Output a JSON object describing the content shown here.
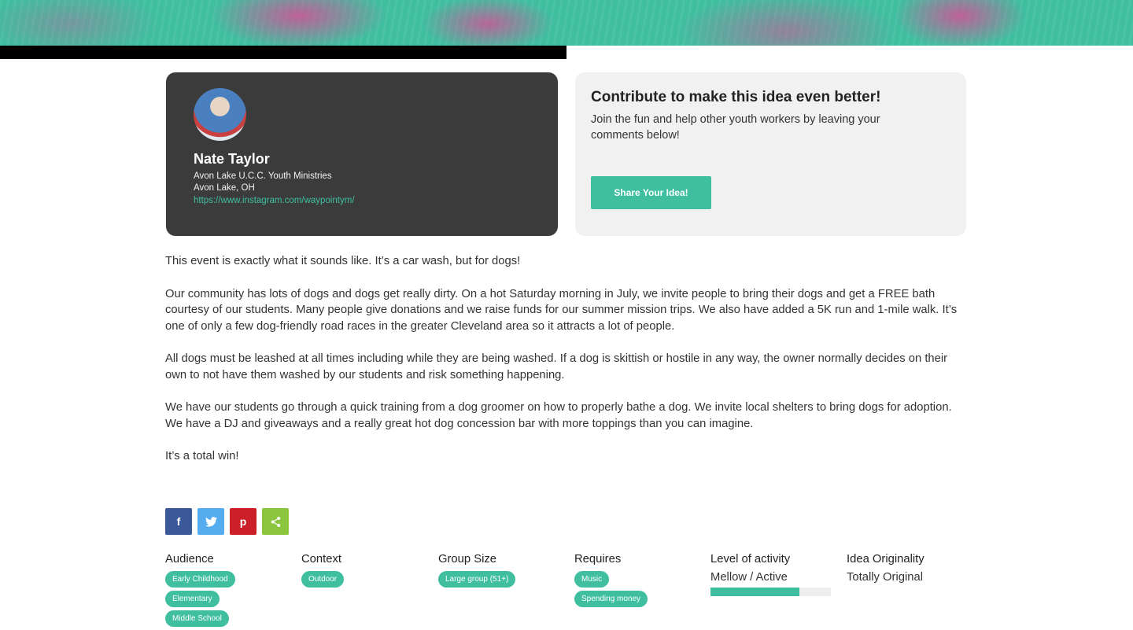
{
  "author": {
    "name": "Nate Taylor",
    "org": "Avon Lake U.C.C. Youth Ministries",
    "location": "Avon Lake, OH",
    "link": "https://www.instagram.com/waypointym/"
  },
  "contribute": {
    "title": "Contribute to make this idea even better!",
    "text": "Join the fun and help other youth workers by leaving your comments below!",
    "button": "Share Your Idea!"
  },
  "article": {
    "p1": "This event is exactly what it sounds like. It’s a car wash, but for dogs!",
    "p2": "Our community has lots of dogs and dogs get really dirty. On a hot Saturday morning in July,  we invite people to bring their dogs and get a FREE bath courtesy of our students. Many people give donations and we raise funds for our summer mission trips. We also have added a 5K run and 1-mile walk. It’s one of only a few dog-friendly road races in the greater Cleveland area so it attracts a lot of people.",
    "p3": "All dogs must be leashed at all times including while they are being washed. If a dog is skittish or hostile in any way, the owner normally decides on their own to not have them washed by our students and risk something happening.",
    "p4": "We have our students go through a quick training from a dog groomer on how to properly bathe a dog. We invite local shelters to bring dogs for adoption. We have a DJ and giveaways and a really great hot dog concession bar with more toppings than you can imagine.",
    "p5": "It’s a total win!"
  },
  "share": {
    "facebook_glyph": "f",
    "pinterest_glyph": "p"
  },
  "meta": {
    "audience": {
      "label": "Audience",
      "tags": [
        "Early Childhood",
        "Elementary",
        "Middle School"
      ]
    },
    "context": {
      "label": "Context",
      "tags": [
        "Outdoor"
      ]
    },
    "group_size": {
      "label": "Group Size",
      "tags": [
        "Large group (51+)"
      ]
    },
    "requires": {
      "label": "Requires",
      "tags": [
        "Music",
        "Spending money"
      ]
    },
    "level": {
      "label": "Level of activity",
      "value": "Mellow / Active",
      "fill_fraction": 0.74
    },
    "originality": {
      "label": "Idea Originality",
      "value": "Totally Original"
    }
  },
  "colors": {
    "accent": "#3fbfa0",
    "card_dark": "#3b3b3b",
    "card_light": "#f1f1f1"
  }
}
